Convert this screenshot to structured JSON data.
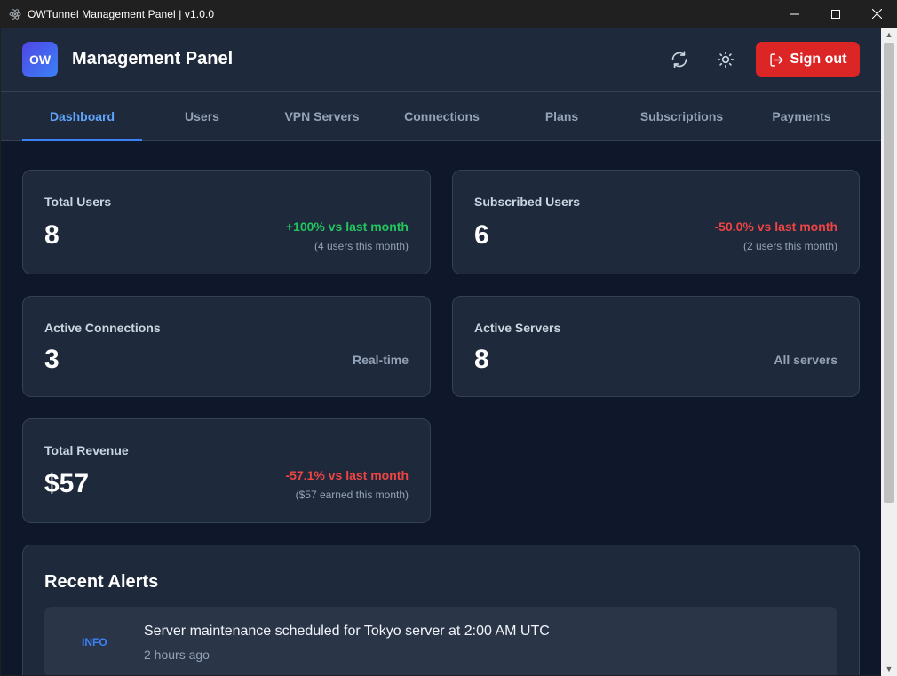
{
  "window": {
    "title": "OWTunnel Management Panel | v1.0.0"
  },
  "header": {
    "logo_text": "OW",
    "brand": "Management Panel",
    "signout_label": "Sign out"
  },
  "tabs": [
    {
      "label": "Dashboard",
      "active": true
    },
    {
      "label": "Users"
    },
    {
      "label": "VPN Servers"
    },
    {
      "label": "Connections"
    },
    {
      "label": "Plans"
    },
    {
      "label": "Subscriptions"
    },
    {
      "label": "Payments"
    }
  ],
  "stats": {
    "total_users": {
      "label": "Total Users",
      "value": "8",
      "trend": "+100% vs last month",
      "sub": "(4 users this month)"
    },
    "subscribed_users": {
      "label": "Subscribed Users",
      "value": "6",
      "trend": "-50.0% vs last month",
      "sub": "(2 users this month)"
    },
    "active_connections": {
      "label": "Active Connections",
      "value": "3",
      "note": "Real-time"
    },
    "active_servers": {
      "label": "Active Servers",
      "value": "8",
      "note": "All servers"
    },
    "total_revenue": {
      "label": "Total Revenue",
      "value": "$57",
      "trend": "-57.1% vs last month",
      "sub": "($57 earned this month)"
    }
  },
  "alerts": {
    "title": "Recent Alerts",
    "items": [
      {
        "level": "INFO",
        "message": "Server maintenance scheduled for Tokyo server at 2:00 AM UTC",
        "time": "2 hours ago"
      }
    ]
  },
  "colors": {
    "accent": "#3b82f6",
    "danger": "#dc2626",
    "positive": "#22c55e",
    "negative": "#ef4444",
    "background": "#0f172a",
    "card": "#1e293b"
  },
  "icons": {
    "app": "electron-icon",
    "refresh": "refresh-icon",
    "theme": "sun-icon",
    "signout": "logout-icon"
  }
}
